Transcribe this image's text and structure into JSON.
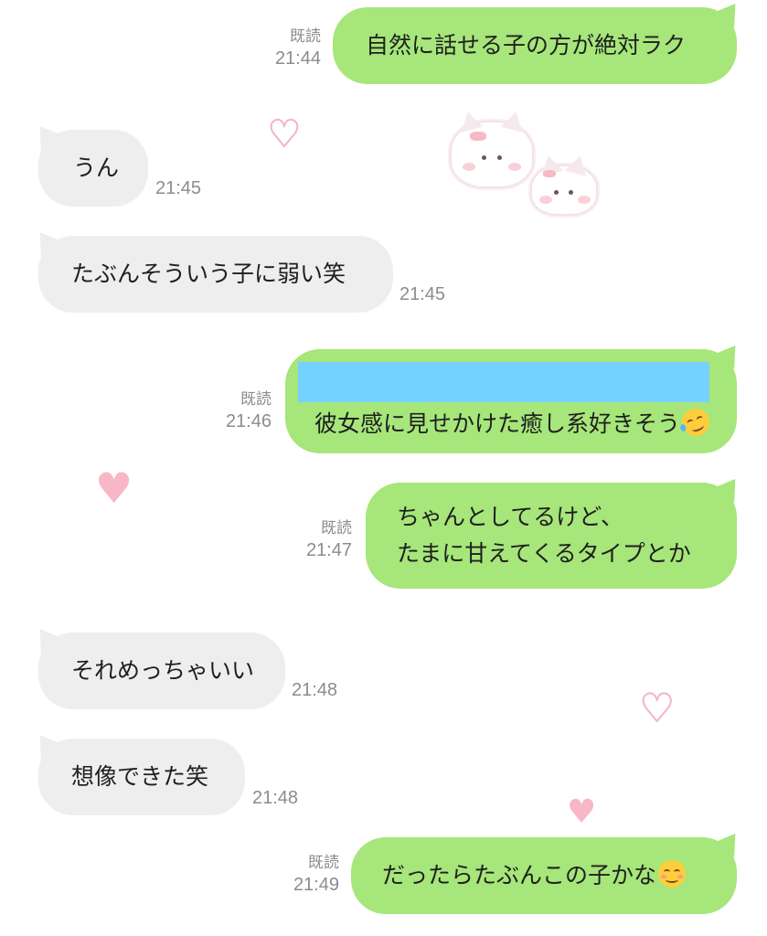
{
  "chat": {
    "messages": [
      {
        "side": "out",
        "text": "自然に話せる子の方が絶対ラク",
        "read": "既読",
        "time": "21:44"
      },
      {
        "side": "in",
        "text": "うん",
        "time": "21:45"
      },
      {
        "side": "in",
        "text": "たぶんそういう子に弱い笑",
        "time": "21:45"
      },
      {
        "side": "out",
        "text": "彼女感に見せかけた癒し系好きそう",
        "read": "既読",
        "time": "21:46",
        "emoji": "rolling-on-floor-laughing"
      },
      {
        "side": "out",
        "text_line1": "ちゃんとしてるけど、",
        "text_line2": "たまに甘えてくるタイプとか",
        "read": "既読",
        "time": "21:47"
      },
      {
        "side": "in",
        "text": "それめっちゃいい",
        "time": "21:48"
      },
      {
        "side": "in",
        "text": "想像できた笑",
        "time": "21:48"
      },
      {
        "side": "out",
        "text": "だったらたぶんこの子かな",
        "read": "既読",
        "time": "21:49",
        "emoji": "smiling-face"
      }
    ]
  },
  "colors": {
    "outgoing_bubble": "#a6e67a",
    "incoming_bubble": "#eeeeee",
    "meta_text": "#8c8c8c",
    "redaction": "#75d1ff",
    "heart": "#f7b7c6"
  }
}
